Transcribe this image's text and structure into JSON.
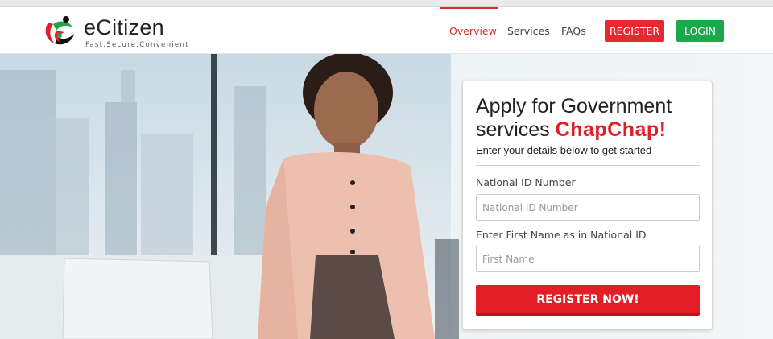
{
  "header": {
    "brand": "eCitizen",
    "tagline": "Fast.Secure.Convenient",
    "nav": {
      "overview": "Overview",
      "services": "Services",
      "faqs": "FAQs"
    },
    "register_label": "REGISTER",
    "login_label": "LOGIN"
  },
  "card": {
    "title_line1": "Apply for Government",
    "title_line2_prefix": "services ",
    "title_accent": "ChapChap!",
    "subtitle": "Enter your details below to get started",
    "id_label": "National ID Number",
    "id_placeholder": "National ID Number",
    "name_label": "Enter First Name as in National ID",
    "name_placeholder": "First Name",
    "submit_label": "REGISTER NOW!"
  },
  "colors": {
    "accent_red": "#e21f26",
    "login_green": "#1aa84a"
  }
}
